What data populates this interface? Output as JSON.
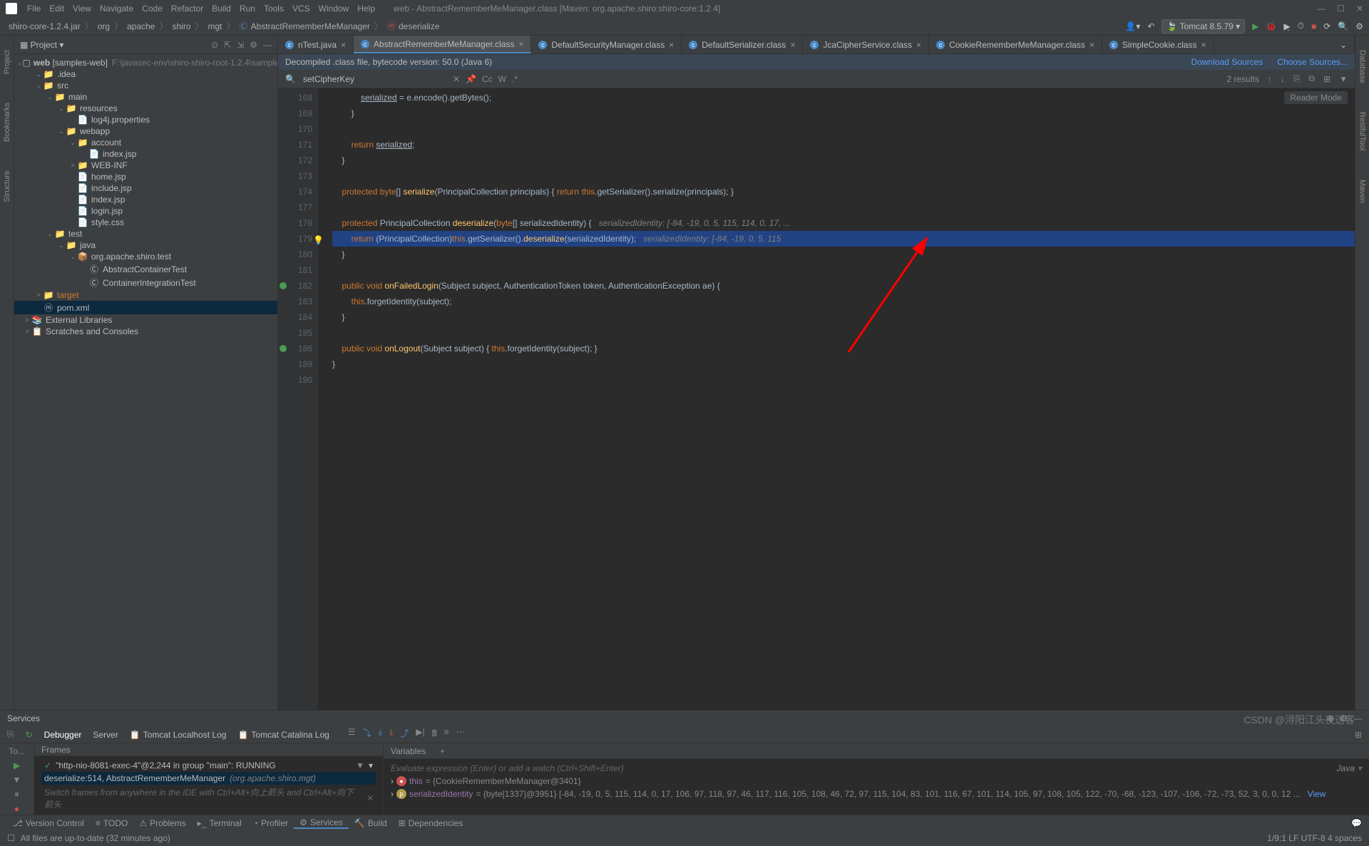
{
  "window": {
    "title": "web - AbstractRememberMeManager.class [Maven: org.apache.shiro:shiro-core:1.2.4]"
  },
  "menus": [
    "File",
    "Edit",
    "View",
    "Navigate",
    "Code",
    "Refactor",
    "Build",
    "Run",
    "Tools",
    "VCS",
    "Window",
    "Help"
  ],
  "breadcrumbs": [
    "shiro-core-1.2.4.jar",
    "org",
    "apache",
    "shiro",
    "mgt",
    "AbstractRememberMeManager",
    "deserialize"
  ],
  "run_config": "Tomcat 8.5.79",
  "project_panel": {
    "title": "Project",
    "root": {
      "name": "web",
      "suffix": "[samples-web]",
      "path": "F:\\javasec-env\\shiro-shiro-root-1.2.4\\samples\\web"
    }
  },
  "tree": [
    {
      "d": 1,
      "exp": true,
      "icon": "📁",
      "label": ".idea"
    },
    {
      "d": 1,
      "exp": true,
      "icon": "📁",
      "label": "src"
    },
    {
      "d": 2,
      "exp": true,
      "icon": "📁",
      "label": "main"
    },
    {
      "d": 3,
      "exp": true,
      "icon": "📁",
      "label": "resources"
    },
    {
      "d": 4,
      "exp": false,
      "icon": "📄",
      "label": "log4j.properties"
    },
    {
      "d": 3,
      "exp": true,
      "icon": "📁",
      "label": "webapp"
    },
    {
      "d": 4,
      "exp": true,
      "icon": "📁",
      "label": "account"
    },
    {
      "d": 5,
      "exp": false,
      "icon": "📄",
      "label": "index.jsp"
    },
    {
      "d": 4,
      "exp": false,
      "icon": "📁",
      "label": "WEB-INF",
      "chev": ">"
    },
    {
      "d": 4,
      "exp": false,
      "icon": "📄",
      "label": "home.jsp"
    },
    {
      "d": 4,
      "exp": false,
      "icon": "📄",
      "label": "include.jsp"
    },
    {
      "d": 4,
      "exp": false,
      "icon": "📄",
      "label": "index.jsp"
    },
    {
      "d": 4,
      "exp": false,
      "icon": "📄",
      "label": "login.jsp"
    },
    {
      "d": 4,
      "exp": false,
      "icon": "📄",
      "label": "style.css"
    },
    {
      "d": 2,
      "exp": true,
      "icon": "📁",
      "label": "test"
    },
    {
      "d": 3,
      "exp": true,
      "icon": "📁",
      "label": "java"
    },
    {
      "d": 4,
      "exp": true,
      "icon": "📦",
      "label": "org.apache.shiro.test"
    },
    {
      "d": 5,
      "exp": false,
      "icon": "Ⓒ",
      "label": "AbstractContainerTest"
    },
    {
      "d": 5,
      "exp": false,
      "icon": "Ⓒ",
      "label": "ContainerIntegrationTest"
    },
    {
      "d": 1,
      "exp": false,
      "icon": "📁",
      "label": "target",
      "chev": ">",
      "orange": true
    },
    {
      "d": 1,
      "exp": false,
      "icon": "ⓜ",
      "label": "pom.xml",
      "selected": true
    },
    {
      "d": 0,
      "exp": false,
      "icon": "📚",
      "label": "External Libraries",
      "chev": ">"
    },
    {
      "d": 0,
      "exp": false,
      "icon": "📋",
      "label": "Scratches and Consoles",
      "chev": ">"
    }
  ],
  "tabs": [
    {
      "label": "nTest.java",
      "active": false
    },
    {
      "label": "AbstractRememberMeManager.class",
      "active": true
    },
    {
      "label": "DefaultSecurityManager.class",
      "active": false
    },
    {
      "label": "DefaultSerializer.class",
      "active": false
    },
    {
      "label": "JcaCipherService.class",
      "active": false
    },
    {
      "label": "CookieRememberMeManager.class",
      "active": false
    },
    {
      "label": "SimpleCookie.class",
      "active": false
    }
  ],
  "info_bar": {
    "text": "Decompiled .class file, bytecode version: 50.0 (Java 6)",
    "link1": "Download Sources",
    "link2": "Choose Sources..."
  },
  "search": {
    "query": "setCipherKey",
    "results": "2 results"
  },
  "reader_mode": "Reader Mode",
  "code_lines": [
    {
      "n": "168",
      "html": "            <span class='underline'>serialized</span> = e.encode().getBytes();"
    },
    {
      "n": "169",
      "html": "        }"
    },
    {
      "n": "170",
      "html": ""
    },
    {
      "n": "171",
      "html": "        <span class='kw'>return</span> <span class='underline'>serialized</span>;"
    },
    {
      "n": "172",
      "html": "    }"
    },
    {
      "n": "173",
      "html": ""
    },
    {
      "n": "174",
      "html": "    <span class='kw'>protected</span> <span class='kw'>byte</span>[] <span class='fn'>serialize</span>(PrincipalCollection principals) { <span class='kw'>return</span> <span class='this'>this</span>.getSerializer().serialize(principals); }"
    },
    {
      "n": "177",
      "html": ""
    },
    {
      "n": "178",
      "html": "    <span class='kw'>protected</span> PrincipalCollection <span class='fn'>deserialize</span>(<span class='kw'>byte</span>[] serializedIdentity) {   <span class='comment'>serializedIdentity: [-84, -19, 0, 5, 115, 114, 0, 17, ...</span>"
    },
    {
      "n": "179",
      "html": "        <span class='kw'>return</span> (PrincipalCollection)<span class='this'>this</span>.getSerializer().<span class='fn'>deserialize</span>(serializedIdentity);   <span class='comment'>serializedIdentity: [-84, -19, 0, 5, 115</span>",
      "hl": true,
      "bulb": true
    },
    {
      "n": "180",
      "html": "    }"
    },
    {
      "n": "181",
      "html": ""
    },
    {
      "n": "182",
      "html": "    <span class='kw'>public</span> <span class='kw'>void</span> <span class='fn'>onFailedLogin</span>(Subject subject, AuthenticationToken token, AuthenticationException ae) {",
      "marker": true
    },
    {
      "n": "183",
      "html": "        <span class='this'>this</span>.forgetIdentity(subject);"
    },
    {
      "n": "184",
      "html": "    }"
    },
    {
      "n": "185",
      "html": ""
    },
    {
      "n": "186",
      "html": "    <span class='kw'>public</span> <span class='kw'>void</span> <span class='fn'>onLogout</span>(Subject subject) { <span class='this'>this</span>.forgetIdentity(subject); }",
      "marker": true
    },
    {
      "n": "189",
      "html": "}"
    },
    {
      "n": "190",
      "html": ""
    }
  ],
  "services": {
    "title": "Services",
    "tabs": [
      "Debugger",
      "Server",
      "Tomcat Localhost Log",
      "Tomcat Catalina Log"
    ],
    "left_label": "To...",
    "frames_title": "Frames",
    "vars_title": "Variables",
    "thread": "\"http-nio-8081-exec-4\"@2,244 in group \"main\": RUNNING",
    "frame": "deserialize:514, AbstractRememberMeManager",
    "frame_pkg": "(org.apache.shiro.mgt)",
    "switch_hint": "Switch frames from anywhere in the IDE with Ctrl+Alt+向上箭头 and Ctrl+Alt+向下箭头",
    "eval_placeholder": "Evaluate expression (Enter) or add a watch (Ctrl+Shift+Enter)",
    "eval_lang": "Java",
    "var_this": "this",
    "var_this_val": "= {CookieRememberMeManager@3401}",
    "var_si": "serializedIdentity",
    "var_si_val": "= {byte[1337]@3951} [-84, -19, 0, 5, 115, 114, 0, 17, 106, 97, 118, 97, 46, 117, 116, 105, 108, 46, 72, 97, 115, 104, 83, 101, 116, 67, 101, 114, 105, 97, 108, 105, 122, -70, -68, -123, -107, -106, -72, -73, 52, 3, 0, 0, 12 ...",
    "view_link": "View"
  },
  "status_items": [
    "Version Control",
    "TODO",
    "Problems",
    "Terminal",
    "Profiler",
    "Services",
    "Build",
    "Dependencies"
  ],
  "status_active": "Services",
  "footer_text": "All files are up-to-date (32 minutes ago)",
  "footer_right": "1/9:1   LF   UTF-8   4 spaces",
  "watermark": "CSDN @浔阳江头夜送客"
}
